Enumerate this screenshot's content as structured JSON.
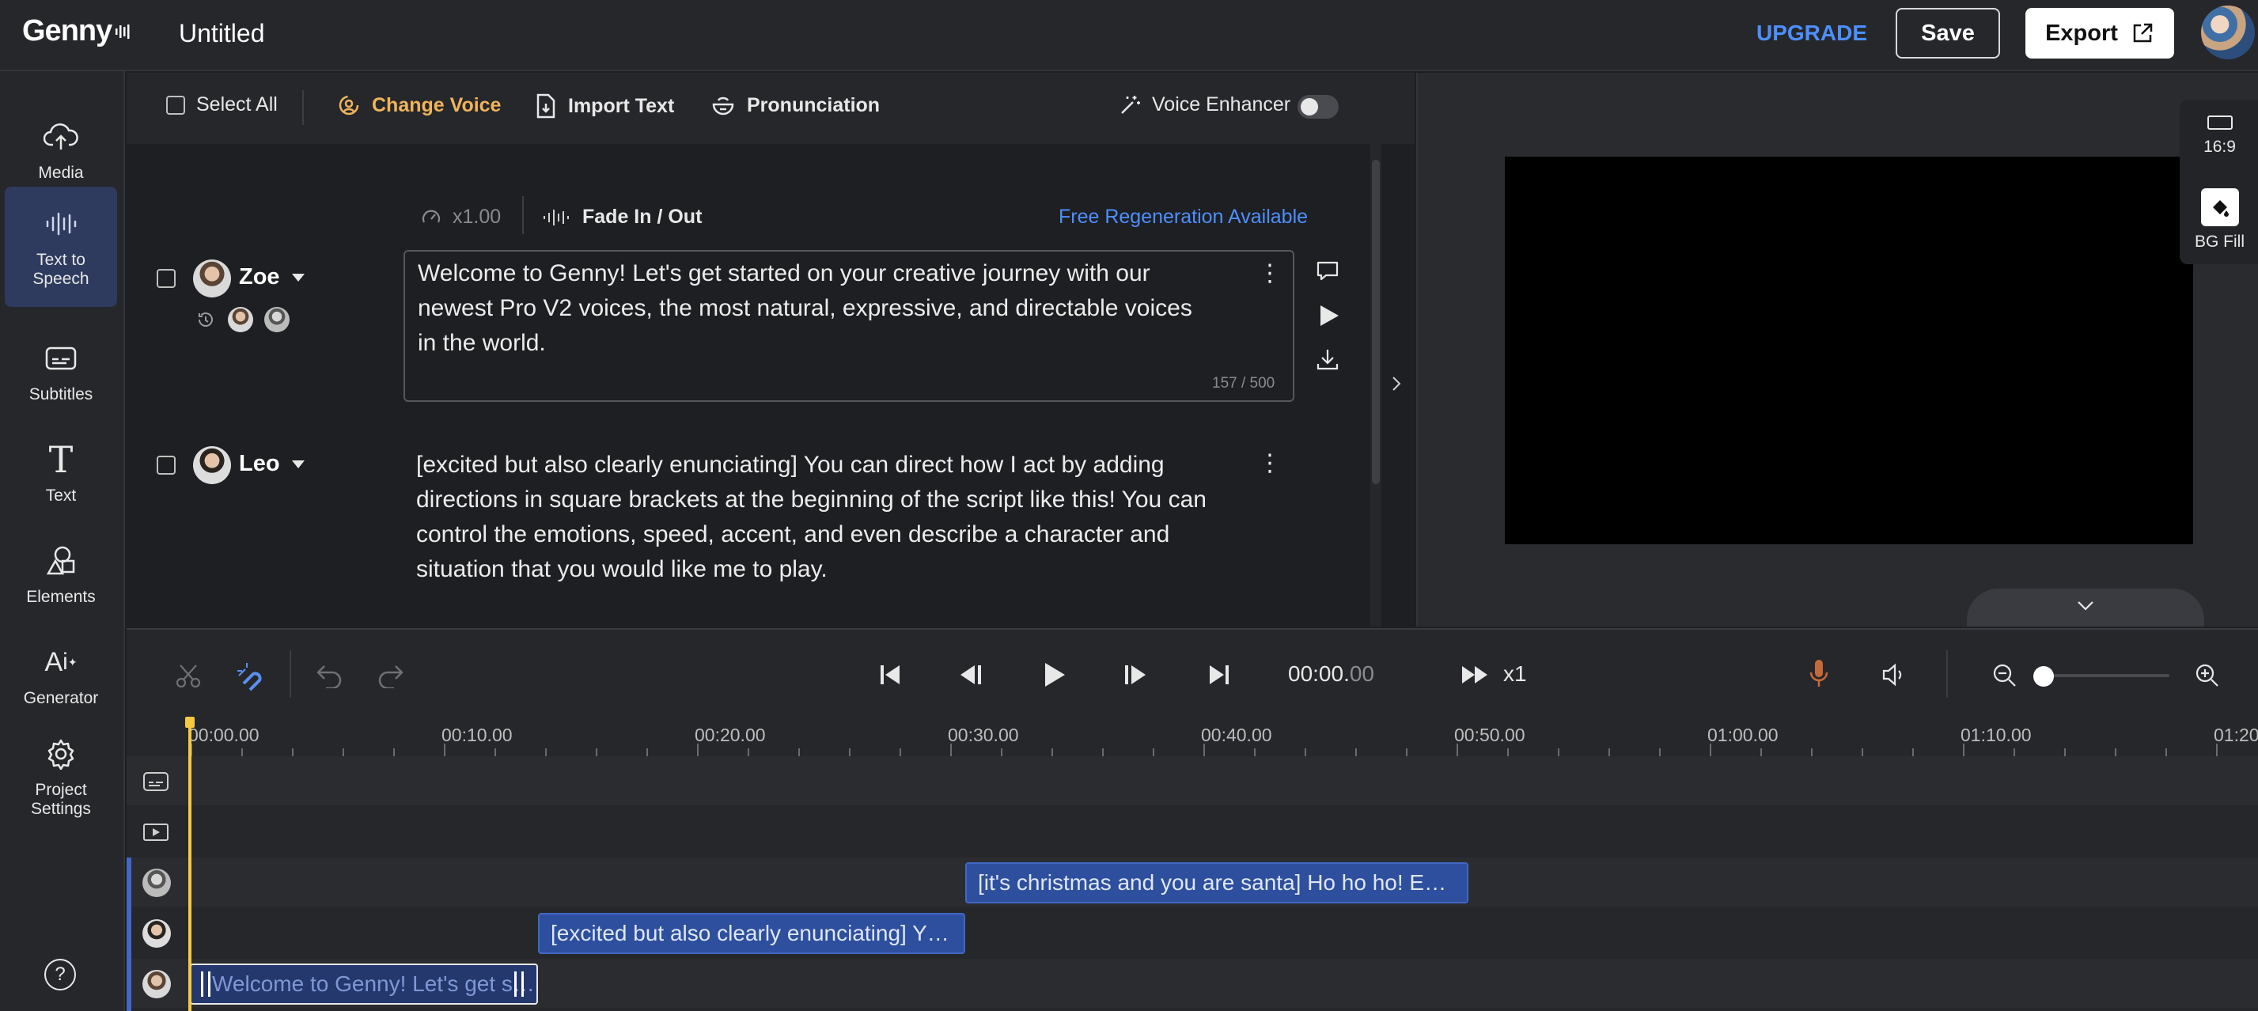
{
  "header": {
    "logo": "Genny",
    "title": "Untitled",
    "upgrade": "UPGRADE",
    "save": "Save",
    "export": "Export"
  },
  "sidebar": {
    "items": [
      {
        "label": "Media",
        "icon": "cloud-upload-icon"
      },
      {
        "label": "Text to Speech",
        "icon": "waveform-icon"
      },
      {
        "label": "Subtitles",
        "icon": "subtitles-icon"
      },
      {
        "label": "Text",
        "icon": "text-t-icon"
      },
      {
        "label": "Elements",
        "icon": "shapes-icon"
      },
      {
        "label": "Generator",
        "icon": "ai-icon"
      },
      {
        "label": "Project Settings",
        "icon": "gear-icon"
      }
    ],
    "active_index": 1
  },
  "toolbar": {
    "select_all": "Select All",
    "change_voice": "Change Voice",
    "import_text": "Import Text",
    "pronunciation": "Pronunciation",
    "voice_enhancer": "Voice Enhancer"
  },
  "blocks": [
    {
      "speed": "x1.00",
      "fade": "Fade In / Out",
      "regen": "Free Regeneration Available",
      "speaker": "Zoe",
      "text": "Welcome to Genny! Let's get started on your creative journey with our newest Pro V2 voices, the most natural, expressive, and directable voices in the world.",
      "count": "157 / 500"
    },
    {
      "speaker": "Leo",
      "text": "[excited but also clearly enunciating] You can direct how I act by adding directions in square brackets at the beginning of the script like this! You can control the emotions, speed, accent, and even describe a character and situation that you would like me to play."
    }
  ],
  "preview": {
    "ratio": "16:9",
    "bg_fill": "BG Fill"
  },
  "timeline": {
    "time_main": "00:00.",
    "time_frac": "00",
    "speed": "x1",
    "ruler": [
      "00:00.00",
      "00:10.00",
      "00:20.00",
      "00:30.00",
      "00:40.00",
      "00:50.00",
      "01:00.00",
      "01:10.00",
      "01:20"
    ],
    "clips": [
      {
        "text": "[it's christmas and you are santa] Ho ho ho! E…"
      },
      {
        "text": "[excited but also clearly enunciating] Y…"
      },
      {
        "text": "Welcome to Genny! Let's get s…"
      }
    ]
  },
  "colors": {
    "accent": "#4d8fff",
    "change_voice": "#f0b45a",
    "clip": "#2d4f9d",
    "playhead": "#f5c842"
  }
}
